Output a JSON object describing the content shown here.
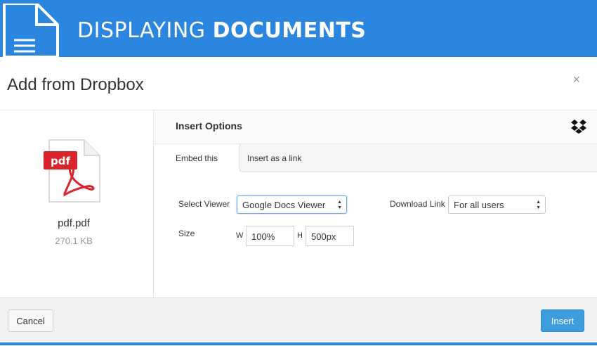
{
  "banner": {
    "title_light": "DISPLAYING ",
    "title_bold": "DOCUMENTS",
    "icon": "document-icon"
  },
  "modal": {
    "title": "Add from Dropbox",
    "close_symbol": "×"
  },
  "file": {
    "icon_label": "pdf",
    "name": "pdf.pdf",
    "size": "270.1 KB"
  },
  "panel": {
    "title": "Insert Options",
    "icon": "dropbox-icon"
  },
  "tabs": [
    {
      "label": "Embed this",
      "active": true
    },
    {
      "label": "Insert as a link",
      "active": false
    }
  ],
  "form": {
    "viewer_label": "Select Viewer",
    "viewer_value": "Google Docs Viewer",
    "download_label": "Download Link",
    "download_value": "For all users",
    "size_label": "Size",
    "width_prefix": "W",
    "width_value": "100%",
    "height_prefix": "H",
    "height_value": "500px"
  },
  "footer": {
    "cancel_label": "Cancel",
    "insert_label": "Insert"
  },
  "colors": {
    "banner": "#2a86de",
    "insert_button": "#3d9ddc",
    "pdf_red": "#d9242b"
  }
}
